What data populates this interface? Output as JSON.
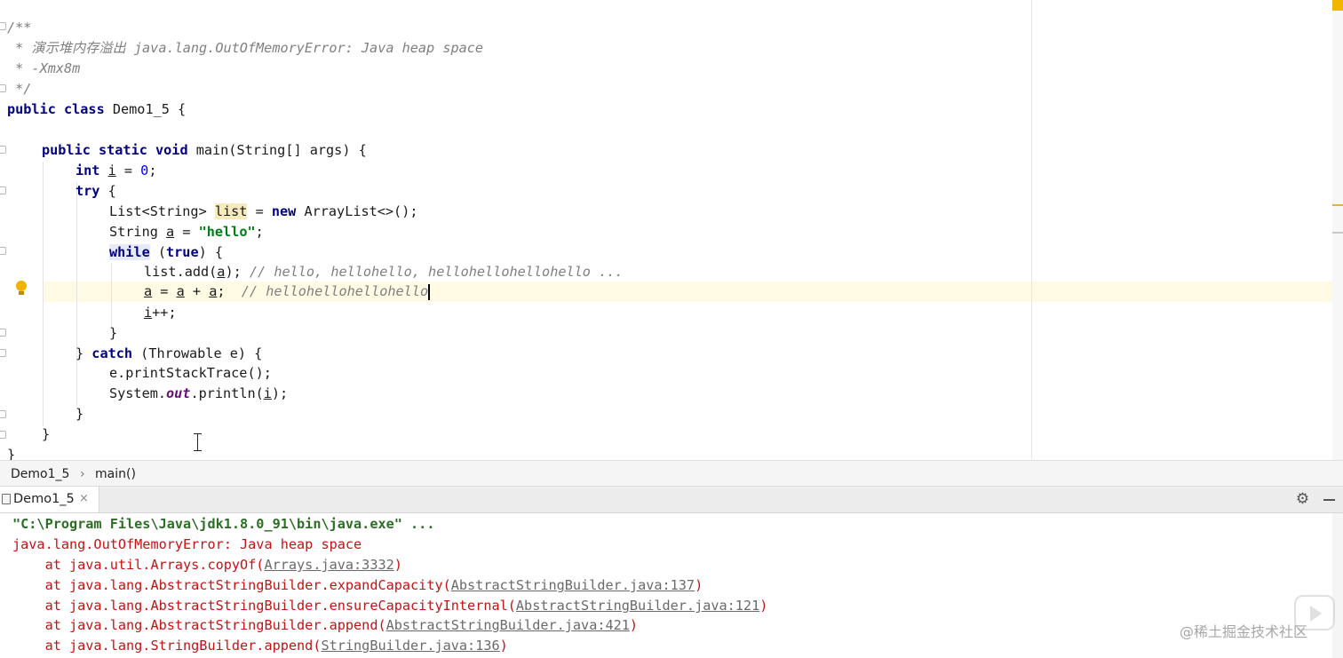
{
  "editor": {
    "lines": {
      "l01": "/**",
      "l02": " * 演示堆内存溢出 java.lang.OutOfMemoryError: Java heap space",
      "l03": " * -Xmx8m",
      "l04": " */",
      "l05_kw": "public class ",
      "l05_rest": "Demo1_5 {",
      "l07_kw": "public static void ",
      "l07_rest": "main(String[] args) {",
      "l08_kw": "int ",
      "l08_var": "i",
      "l08_eq": " = ",
      "l08_num": "0",
      "l08_end": ";",
      "l09_kw": "try",
      "l09_rest": " {",
      "l10_a": "List<String> ",
      "l10_var": "list",
      "l10_b": " = ",
      "l10_kw": "new",
      "l10_c": " ArrayList<>();",
      "l11_a": "String ",
      "l11_var": "a",
      "l11_b": " = ",
      "l11_str": "\"hello\"",
      "l11_end": ";",
      "l12_kw": "while",
      "l12_b": " (",
      "l12_kw2": "true",
      "l12_c": ") {",
      "l13_a": "list.add(",
      "l13_var": "a",
      "l13_b": "); ",
      "l13_cm": "// hello, hellohello, hellohellohellohello ...",
      "l14_v1": "a",
      "l14_eq": " = ",
      "l14_v2": "a",
      "l14_plus": " + ",
      "l14_v3": "a",
      "l14_semi": ";  ",
      "l14_cm": "// hellohellohellohello",
      "l15_var": "i",
      "l15_rest": "++;",
      "l16": "}",
      "l17_a": "} ",
      "l17_kw": "catch",
      "l17_b": " (Throwable e) {",
      "l18": "e.printStackTrace();",
      "l19_a": "System.",
      "l19_fld": "out",
      "l19_b": ".println(",
      "l19_var": "i",
      "l19_c": ");",
      "l20": "}",
      "l21": "}",
      "l22": "}"
    }
  },
  "breadcrumb": {
    "class_name": "Demo1_5",
    "separator": "›",
    "method_name": "main()"
  },
  "run_window": {
    "tab_label": "Demo1_5",
    "tab_close": "×",
    "gear_glyph": "⚙"
  },
  "console": {
    "cmd": "\"C:\\Program Files\\Java\\jdk1.8.0_91\\bin\\java.exe\" ...",
    "error": "java.lang.OutOfMemoryError: Java heap space",
    "stack": [
      {
        "prefix": "    at java.util.Arrays.copyOf(",
        "link": "Arrays.java:3332",
        "suffix": ")"
      },
      {
        "prefix": "    at java.lang.AbstractStringBuilder.expandCapacity(",
        "link": "AbstractStringBuilder.java:137",
        "suffix": ")"
      },
      {
        "prefix": "    at java.lang.AbstractStringBuilder.ensureCapacityInternal(",
        "link": "AbstractStringBuilder.java:121",
        "suffix": ")"
      },
      {
        "prefix": "    at java.lang.AbstractStringBuilder.append(",
        "link": "AbstractStringBuilder.java:421",
        "suffix": ")"
      },
      {
        "prefix": "    at java.lang.StringBuilder.append(",
        "link": "StringBuilder.java:136",
        "suffix": ")"
      }
    ]
  },
  "watermark": "@稀土掘金技术社区",
  "colors": {
    "keyword": "#000080",
    "comment": "#808080",
    "string": "#007d17",
    "number": "#0000ff",
    "error_text": "#c41313",
    "current_line": "#fffae3",
    "identifier_highlight": "#f6ebbc"
  }
}
